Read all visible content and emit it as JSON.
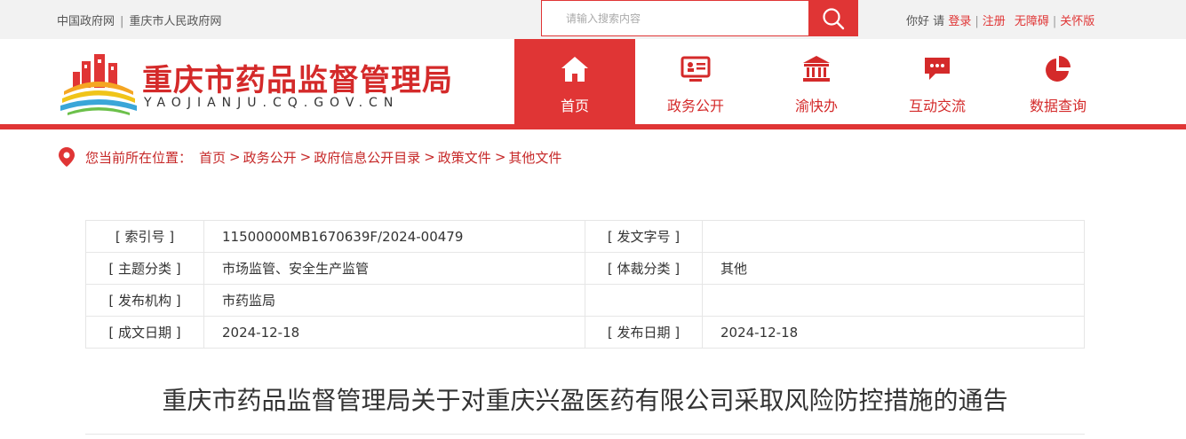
{
  "topbar": {
    "links": [
      "中国政府网",
      "重庆市人民政府网"
    ],
    "search_placeholder": "请输入搜索内容",
    "greeting": "你好",
    "please": "请",
    "login": "登录",
    "register": "注册",
    "accessibility": "无障碍",
    "care": "关怀版"
  },
  "header": {
    "site_title": "重庆市药品监督管理局",
    "site_domain": "YAOJIANJU.CQ.GOV.CN"
  },
  "nav": {
    "items": [
      {
        "label": "首页",
        "icon": "home-icon",
        "active": true
      },
      {
        "label": "政务公开",
        "icon": "news-board-icon"
      },
      {
        "label": "渝快办",
        "icon": "government-building-icon"
      },
      {
        "label": "互动交流",
        "icon": "chat-icon"
      },
      {
        "label": "数据查询",
        "icon": "pie-chart-icon"
      }
    ]
  },
  "breadcrumb": {
    "prefix": "您当前所在位置：",
    "items": [
      "首页",
      "政务公开",
      "政府信息公开目录",
      "政策文件",
      "其他文件"
    ]
  },
  "info_table": {
    "rows": [
      {
        "k1": "[ 索引号 ]",
        "v1": "11500000MB1670639F/2024-00479",
        "k2": "[ 发文字号 ]",
        "v2": ""
      },
      {
        "k1": "[ 主题分类 ]",
        "v1": "市场监管、安全生产监管",
        "k2": "[ 体裁分类 ]",
        "v2": "其他"
      },
      {
        "k1": "[ 发布机构 ]",
        "v1": "市药监局",
        "k2": "",
        "v2": ""
      },
      {
        "k1": "[ 成文日期 ]",
        "v1": "2024-12-18",
        "k2": "[ 发布日期 ]",
        "v2": "2024-12-18"
      }
    ]
  },
  "document": {
    "title": "重庆市药品监督管理局关于对重庆兴盈医药有限公司采取风险防控措施的通告"
  },
  "colors": {
    "accent": "#e03535",
    "title_red": "#d42a2a"
  }
}
